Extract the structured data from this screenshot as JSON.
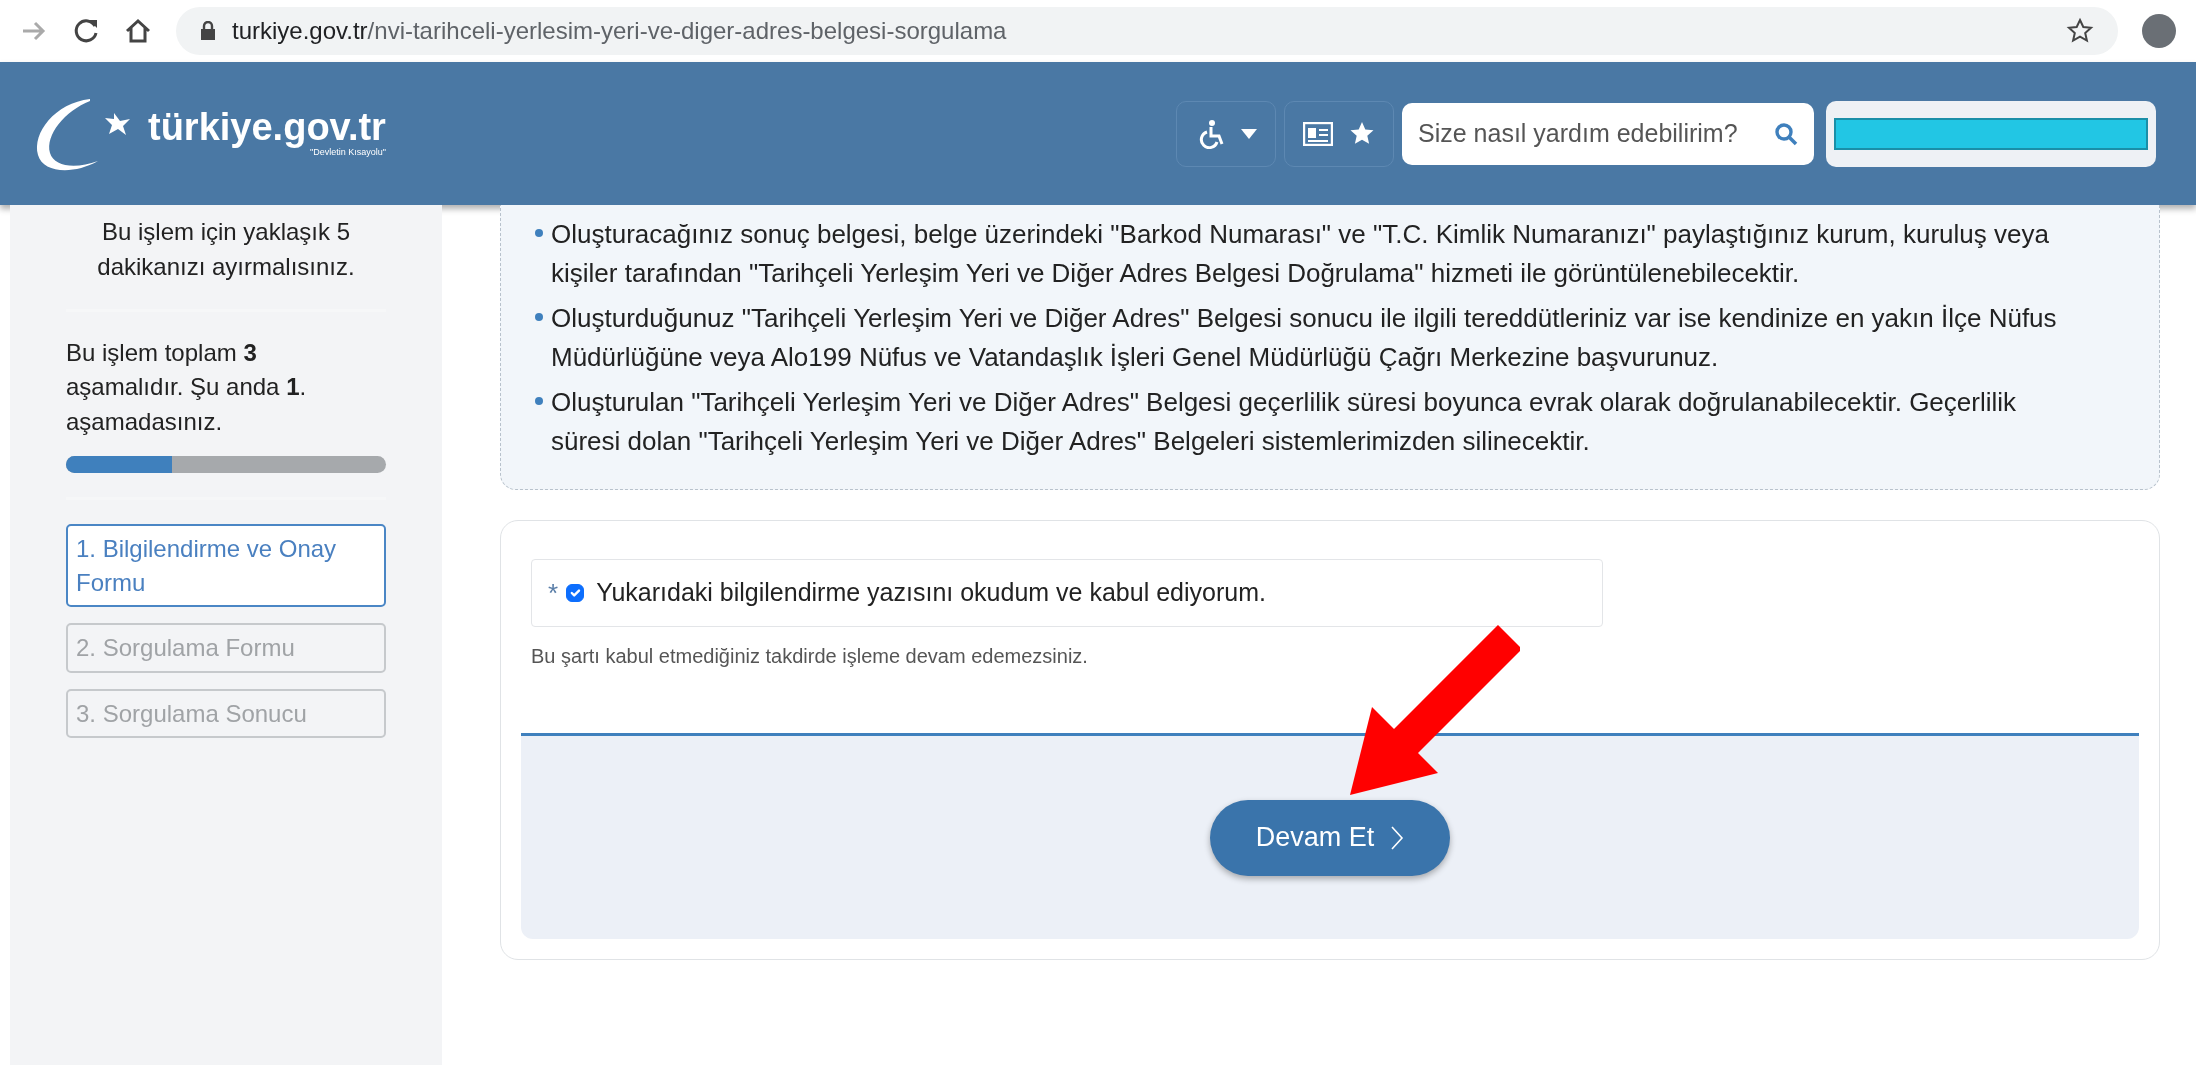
{
  "browser": {
    "url_host": "turkiye.gov.tr",
    "url_path": "/nvi-tarihceli-yerlesim-yeri-ve-diger-adres-belgesi-sorgulama"
  },
  "header": {
    "logo_text": "türkiye.gov.tr",
    "logo_tagline": "\"Devletin Kısayolu\"",
    "search": {
      "placeholder": "Size nasıl yardım edebilirim?"
    }
  },
  "sidebar": {
    "duration_note": "Bu işlem için yaklaşık 5 dakikanızı ayırmalısınız.",
    "progress_text": "Bu işlem toplam **3** aşamalıdır. Şu anda **1**. aşamadasınız.",
    "progress": {
      "level": 0.33
    },
    "steps": [
      {
        "label": "1. Bilgilendirme ve Onay Formu",
        "selected": true
      },
      {
        "label": "2. Sorgulama Formu",
        "selected": false
      },
      {
        "label": "3. Sorgulama Sonucu",
        "selected": false
      }
    ]
  },
  "info": {
    "bullets": [
      "Oluşturacağınız sonuç belgesi, belge üzerindeki \"Barkod Numarası\" ve \"T.C. Kimlik Numaranızı\" paylaştığınız kurum, kuruluş veya kişiler tarafından \"Tarihçeli Yerleşim Yeri ve Diğer Adres Belgesi Doğrulama\" hizmeti ile görüntülenebilecektir.",
      "Oluşturduğunuz \"Tarihçeli Yerleşim Yeri ve Diğer Adres\" Belgesi sonucu ile ilgili tereddütleriniz var ise kendinize en yakın İlçe Nüfus Müdürlüğüne veya Alo199 Nüfus ve Vatandaşlık İşleri Genel Müdürlüğü Çağrı Merkezine başvurunuz.",
      "Oluşturulan \"Tarihçeli Yerleşim Yeri ve Diğer Adres\" Belgesi geçerlilik süresi boyunca evrak olarak doğrulanabilecektir. Geçerlilik süresi dolan \"Tarihçeli Yerleşim Yeri ve Diğer Adres\" Belgeleri sistemlerimizden silinecektir."
    ]
  },
  "form": {
    "consent": {
      "required_mark": "*",
      "label": "Yukarıdaki bilgilendirme yazısını okudum ve kabul ediyorum.",
      "checked": true
    },
    "hint": "Bu şartı kabul etmediğiniz takdirde işleme devam edemezsiniz.",
    "submit": {
      "label": "Devam Et"
    }
  }
}
